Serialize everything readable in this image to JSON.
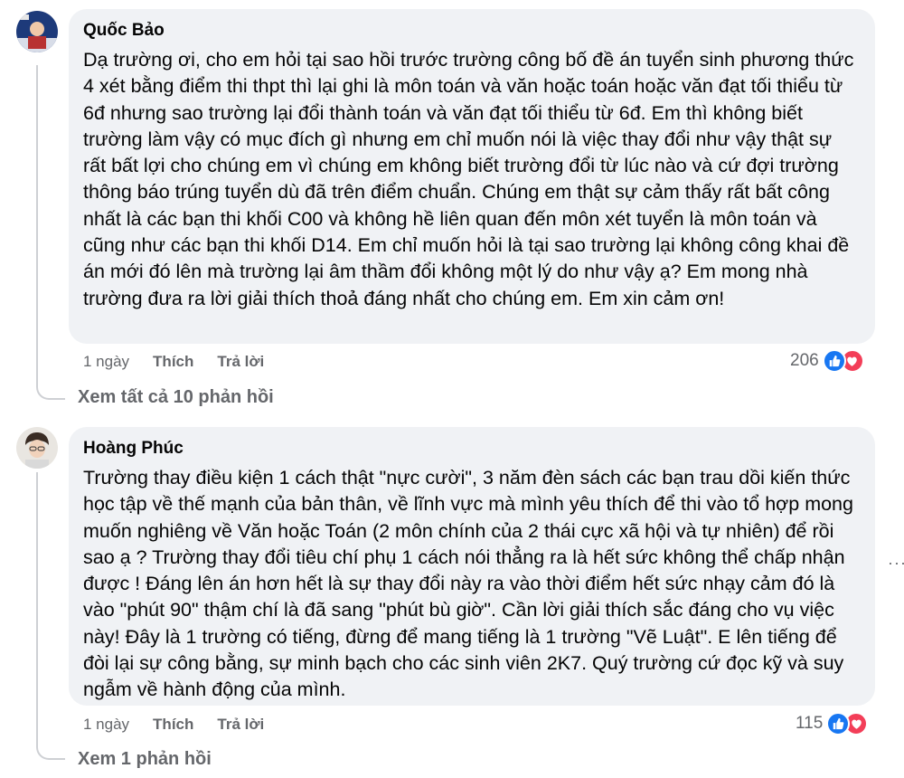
{
  "comments": [
    {
      "author": "Quốc Bảo",
      "text": "Dạ trường ơi, cho em hỏi tại sao hồi trước trường công bố đề án tuyển sinh phương thức 4 xét bằng điểm thi thpt thì lại ghi là môn toán và văn hoặc toán hoặc văn đạt tối thiểu từ 6đ nhưng sao trường lại đổi thành toán và văn đạt tối thiểu từ 6đ. Em thì không biết trường làm vậy có mục đích gì nhưng em chỉ muốn nói là việc thay đổi như vậy thật sự rất bất lợi cho chúng em vì chúng em không biết trường đổi từ lúc nào và cứ đợi trường thông báo trúng tuyển dù đã trên điểm chuẩn. Chúng em thật sự cảm thấy rất bất công nhất là các bạn thi khối C00 và không hề liên quan đến môn xét tuyển là môn toán và cũng như các bạn thi khối D14. Em chỉ muốn hỏi là tại sao trường lại không công khai đề án mới đó lên mà trường lại âm thầm đổi không một lý do như vậy ạ? Em mong nhà trường đưa ra lời giải thích thoả đáng nhất cho chúng em. Em xin cảm ơn!",
      "time": "1 ngày",
      "like_label": "Thích",
      "reply_label": "Trả lời",
      "reaction_count": "206",
      "view_replies": "Xem tất cả 10 phản hồi"
    },
    {
      "author": "Hoàng Phúc",
      "text": "Trường thay điều kiện 1 cách thật \"nực cười\", 3 năm đèn sách các bạn trau dồi kiến thức học tập về thế mạnh của bản thân, về lĩnh vực mà mình yêu thích để thi vào tổ hợp mong muốn nghiêng về Văn hoặc Toán (2 môn chính của 2 thái cực xã hội và tự nhiên) để rồi sao ạ ? Trường thay đổi tiêu chí phụ 1 cách nói thẳng ra là hết sức không thể chấp nhận được ! Đáng lên án hơn hết là sự thay đổi này ra vào thời điểm hết sức nhạy cảm đó là vào \"phút 90\" thậm chí là đã sang \"phút bù giờ\". Cần lời giải thích sắc đáng cho vụ việc này! Đây là 1 trường có tiếng, đừng để mang tiếng là 1 trường \"Vẽ Luật\". E lên tiếng để đòi lại sự công bằng, sự minh bạch cho các sinh viên 2K7. Quý trường cứ đọc kỹ và suy ngẫm về hành động của mình.",
      "time": "1 ngày",
      "like_label": "Thích",
      "reply_label": "Trả lời",
      "reaction_count": "115",
      "view_replies": "Xem 1 phản hồi"
    }
  ],
  "icons": {
    "like": "thumbs-up-icon",
    "love": "heart-icon",
    "more": "more-options-icon"
  },
  "colors": {
    "bubble": "#f0f2f5",
    "meta_text": "#65676b",
    "like_blue": "#1877f2",
    "love_red": "#f33e58"
  }
}
